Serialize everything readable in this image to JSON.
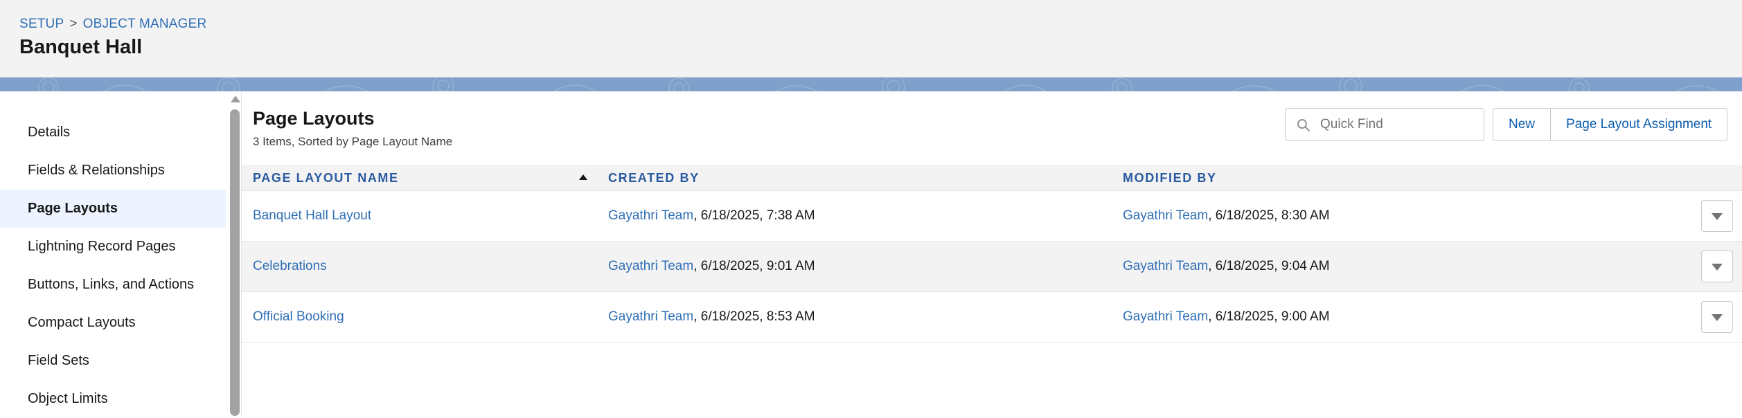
{
  "header": {
    "breadcrumb": {
      "setup": "SETUP",
      "separator": ">",
      "object_manager": "OBJECT MANAGER"
    },
    "title": "Banquet Hall"
  },
  "sidebar": {
    "items": [
      {
        "label": "Details",
        "active": false
      },
      {
        "label": "Fields & Relationships",
        "active": false
      },
      {
        "label": "Page Layouts",
        "active": true
      },
      {
        "label": "Lightning Record Pages",
        "active": false
      },
      {
        "label": "Buttons, Links, and Actions",
        "active": false
      },
      {
        "label": "Compact Layouts",
        "active": false
      },
      {
        "label": "Field Sets",
        "active": false
      },
      {
        "label": "Object Limits",
        "active": false
      }
    ]
  },
  "main": {
    "title": "Page Layouts",
    "subtitle": "3 Items, Sorted by Page Layout Name",
    "search": {
      "placeholder": "Quick Find",
      "value": ""
    },
    "buttons": {
      "new": "New",
      "assignment": "Page Layout Assignment"
    },
    "table": {
      "columns": {
        "name": "PAGE LAYOUT NAME",
        "created_by": "CREATED BY",
        "modified_by": "MODIFIED BY"
      },
      "sort_column": "PAGE LAYOUT NAME",
      "rows": [
        {
          "name": "Banquet Hall Layout",
          "created_user": "Gayathri Team",
          "created_date": ", 6/18/2025, 7:38 AM",
          "modified_user": "Gayathri Team",
          "modified_date": ", 6/18/2025, 8:30 AM"
        },
        {
          "name": "Celebrations",
          "created_user": "Gayathri Team",
          "created_date": ", 6/18/2025, 9:01 AM",
          "modified_user": "Gayathri Team",
          "modified_date": ", 6/18/2025, 9:04 AM"
        },
        {
          "name": "Official Booking",
          "created_user": "Gayathri Team",
          "created_date": ", 6/18/2025, 8:53 AM",
          "modified_user": "Gayathri Team",
          "modified_date": ", 6/18/2025, 9:00 AM"
        }
      ]
    }
  },
  "colors": {
    "link": "#2f6eb5",
    "header_bg": "#f3f3f3",
    "band": "#7ea0cb",
    "active_item_bg": "#eef4ff",
    "column_header": "#2a5aa0"
  }
}
